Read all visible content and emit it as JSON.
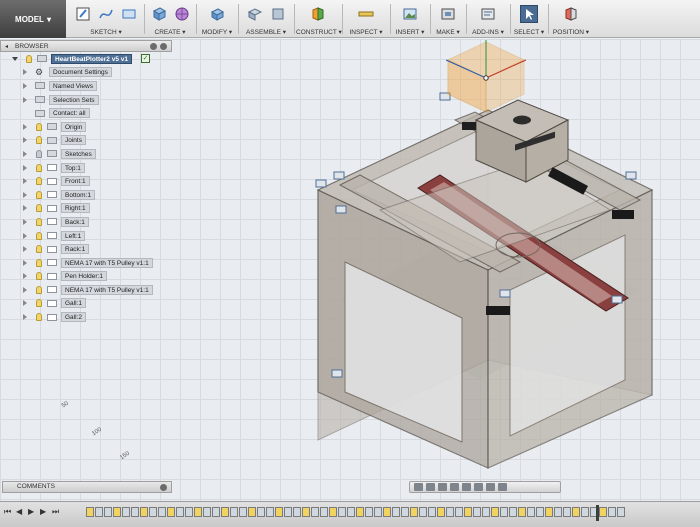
{
  "toolbar": {
    "model_label": "MODEL",
    "groups": [
      {
        "label": "SKETCH ▾",
        "icons": [
          "edit-sketch-icon",
          "spline-icon",
          "rectangle-icon"
        ]
      },
      {
        "label": "CREATE ▾",
        "icons": [
          "box-icon",
          "sphere-grid-icon"
        ]
      },
      {
        "label": "MODIFY ▾",
        "icons": [
          "press-pull-icon"
        ]
      },
      {
        "label": "ASSEMBLE ▾",
        "icons": [
          "component-icon",
          "joint-icon"
        ]
      },
      {
        "label": "CONSTRUCT ▾",
        "icons": [
          "plane-icon"
        ]
      },
      {
        "label": "INSPECT ▾",
        "icons": [
          "measure-icon"
        ]
      },
      {
        "label": "INSERT ▾",
        "icons": [
          "image-icon"
        ]
      },
      {
        "label": "MAKE ▾",
        "icons": [
          "print-icon"
        ]
      },
      {
        "label": "ADD-INS ▾",
        "icons": [
          "scripts-icon"
        ]
      },
      {
        "label": "SELECT ▾",
        "icons": [
          "cursor-icon"
        ]
      },
      {
        "label": "POSITION ▾",
        "icons": [
          "capture-position-icon"
        ]
      }
    ]
  },
  "browser": {
    "title": "BROWSER",
    "root": "HeartBeatPlotter2 v5 v1",
    "items": [
      "Document Settings",
      "Named Views",
      "Selection Sets",
      "Contact: all",
      "Origin",
      "Joints",
      "Sketches",
      "Top:1",
      "Front:1",
      "Bottom:1",
      "Right:1",
      "Back:1",
      "Left:1",
      "Rack:1",
      "NEMA 17 with T5 Pulley v1:1",
      "Pen Holder:1",
      "NEMA 17 with T5 Pulley v1:1",
      "Gall:1",
      "Gall:2"
    ]
  },
  "axis_numbers": [
    "50",
    "100",
    "150"
  ],
  "comments": {
    "label": "COMMENTS"
  },
  "colors": {
    "accent": "#4f6f94",
    "rack": "#8b4040",
    "frame": "#b9b3ab",
    "viewcube": "#f2a33a"
  }
}
